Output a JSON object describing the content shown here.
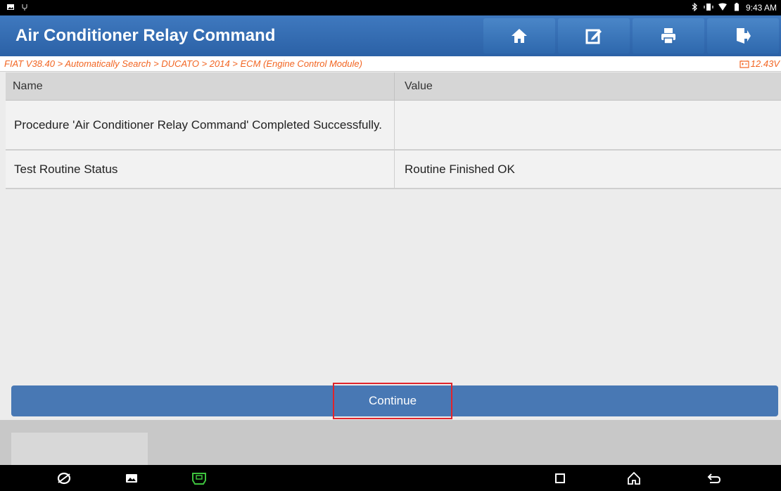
{
  "status_bar": {
    "left_icons": [
      "image-notification-icon",
      "usb-icon"
    ],
    "right_icons": [
      "bluetooth-icon",
      "vibrate-icon",
      "wifi-icon",
      "battery-icon"
    ],
    "time": "9:43 AM"
  },
  "header": {
    "title": "Air Conditioner Relay Command",
    "buttons": [
      "home-icon",
      "edit-report-icon",
      "print-icon",
      "exit-icon"
    ]
  },
  "breadcrumb": {
    "path": "FIAT V38.40 > Automatically Search > DUCATO > 2014 > ECM (Engine Control Module)",
    "voltage": "12.43V"
  },
  "table": {
    "headers": [
      "Name",
      "Value"
    ],
    "rows": [
      {
        "name": "Procedure 'Air Conditioner Relay Command' Completed Successfully.",
        "value": ""
      },
      {
        "name": "Test Routine Status",
        "value": "Routine Finished OK"
      }
    ]
  },
  "continue_label": "Continue",
  "colors": {
    "header_blue": "#2b61a6",
    "breadcrumb_orange": "#f26522",
    "continue_blue": "#4878b4",
    "highlight_red": "#e0242b",
    "vci_green": "#3ec43e"
  },
  "nav_bar": {
    "icons": [
      "browser-icon",
      "gallery-icon",
      "vci-icon",
      "recents-icon",
      "home-nav-icon",
      "back-icon"
    ]
  }
}
